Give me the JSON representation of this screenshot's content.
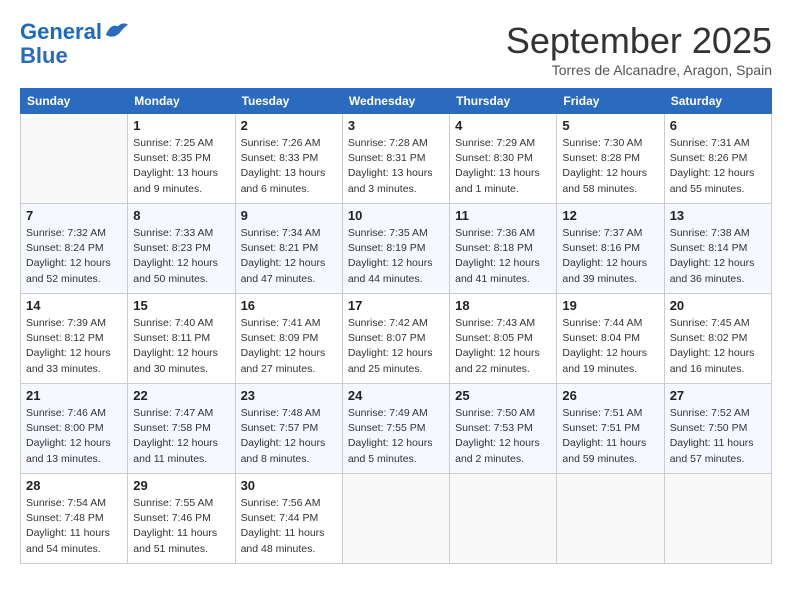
{
  "logo": {
    "line1": "General",
    "line2": "Blue"
  },
  "title": "September 2025",
  "location": "Torres de Alcanadre, Aragon, Spain",
  "days_of_week": [
    "Sunday",
    "Monday",
    "Tuesday",
    "Wednesday",
    "Thursday",
    "Friday",
    "Saturday"
  ],
  "weeks": [
    [
      {
        "day": "",
        "info": ""
      },
      {
        "day": "1",
        "info": "Sunrise: 7:25 AM\nSunset: 8:35 PM\nDaylight: 13 hours\nand 9 minutes."
      },
      {
        "day": "2",
        "info": "Sunrise: 7:26 AM\nSunset: 8:33 PM\nDaylight: 13 hours\nand 6 minutes."
      },
      {
        "day": "3",
        "info": "Sunrise: 7:28 AM\nSunset: 8:31 PM\nDaylight: 13 hours\nand 3 minutes."
      },
      {
        "day": "4",
        "info": "Sunrise: 7:29 AM\nSunset: 8:30 PM\nDaylight: 13 hours\nand 1 minute."
      },
      {
        "day": "5",
        "info": "Sunrise: 7:30 AM\nSunset: 8:28 PM\nDaylight: 12 hours\nand 58 minutes."
      },
      {
        "day": "6",
        "info": "Sunrise: 7:31 AM\nSunset: 8:26 PM\nDaylight: 12 hours\nand 55 minutes."
      }
    ],
    [
      {
        "day": "7",
        "info": "Sunrise: 7:32 AM\nSunset: 8:24 PM\nDaylight: 12 hours\nand 52 minutes."
      },
      {
        "day": "8",
        "info": "Sunrise: 7:33 AM\nSunset: 8:23 PM\nDaylight: 12 hours\nand 50 minutes."
      },
      {
        "day": "9",
        "info": "Sunrise: 7:34 AM\nSunset: 8:21 PM\nDaylight: 12 hours\nand 47 minutes."
      },
      {
        "day": "10",
        "info": "Sunrise: 7:35 AM\nSunset: 8:19 PM\nDaylight: 12 hours\nand 44 minutes."
      },
      {
        "day": "11",
        "info": "Sunrise: 7:36 AM\nSunset: 8:18 PM\nDaylight: 12 hours\nand 41 minutes."
      },
      {
        "day": "12",
        "info": "Sunrise: 7:37 AM\nSunset: 8:16 PM\nDaylight: 12 hours\nand 39 minutes."
      },
      {
        "day": "13",
        "info": "Sunrise: 7:38 AM\nSunset: 8:14 PM\nDaylight: 12 hours\nand 36 minutes."
      }
    ],
    [
      {
        "day": "14",
        "info": "Sunrise: 7:39 AM\nSunset: 8:12 PM\nDaylight: 12 hours\nand 33 minutes."
      },
      {
        "day": "15",
        "info": "Sunrise: 7:40 AM\nSunset: 8:11 PM\nDaylight: 12 hours\nand 30 minutes."
      },
      {
        "day": "16",
        "info": "Sunrise: 7:41 AM\nSunset: 8:09 PM\nDaylight: 12 hours\nand 27 minutes."
      },
      {
        "day": "17",
        "info": "Sunrise: 7:42 AM\nSunset: 8:07 PM\nDaylight: 12 hours\nand 25 minutes."
      },
      {
        "day": "18",
        "info": "Sunrise: 7:43 AM\nSunset: 8:05 PM\nDaylight: 12 hours\nand 22 minutes."
      },
      {
        "day": "19",
        "info": "Sunrise: 7:44 AM\nSunset: 8:04 PM\nDaylight: 12 hours\nand 19 minutes."
      },
      {
        "day": "20",
        "info": "Sunrise: 7:45 AM\nSunset: 8:02 PM\nDaylight: 12 hours\nand 16 minutes."
      }
    ],
    [
      {
        "day": "21",
        "info": "Sunrise: 7:46 AM\nSunset: 8:00 PM\nDaylight: 12 hours\nand 13 minutes."
      },
      {
        "day": "22",
        "info": "Sunrise: 7:47 AM\nSunset: 7:58 PM\nDaylight: 12 hours\nand 11 minutes."
      },
      {
        "day": "23",
        "info": "Sunrise: 7:48 AM\nSunset: 7:57 PM\nDaylight: 12 hours\nand 8 minutes."
      },
      {
        "day": "24",
        "info": "Sunrise: 7:49 AM\nSunset: 7:55 PM\nDaylight: 12 hours\nand 5 minutes."
      },
      {
        "day": "25",
        "info": "Sunrise: 7:50 AM\nSunset: 7:53 PM\nDaylight: 12 hours\nand 2 minutes."
      },
      {
        "day": "26",
        "info": "Sunrise: 7:51 AM\nSunset: 7:51 PM\nDaylight: 11 hours\nand 59 minutes."
      },
      {
        "day": "27",
        "info": "Sunrise: 7:52 AM\nSunset: 7:50 PM\nDaylight: 11 hours\nand 57 minutes."
      }
    ],
    [
      {
        "day": "28",
        "info": "Sunrise: 7:54 AM\nSunset: 7:48 PM\nDaylight: 11 hours\nand 54 minutes."
      },
      {
        "day": "29",
        "info": "Sunrise: 7:55 AM\nSunset: 7:46 PM\nDaylight: 11 hours\nand 51 minutes."
      },
      {
        "day": "30",
        "info": "Sunrise: 7:56 AM\nSunset: 7:44 PM\nDaylight: 11 hours\nand 48 minutes."
      },
      {
        "day": "",
        "info": ""
      },
      {
        "day": "",
        "info": ""
      },
      {
        "day": "",
        "info": ""
      },
      {
        "day": "",
        "info": ""
      }
    ]
  ]
}
